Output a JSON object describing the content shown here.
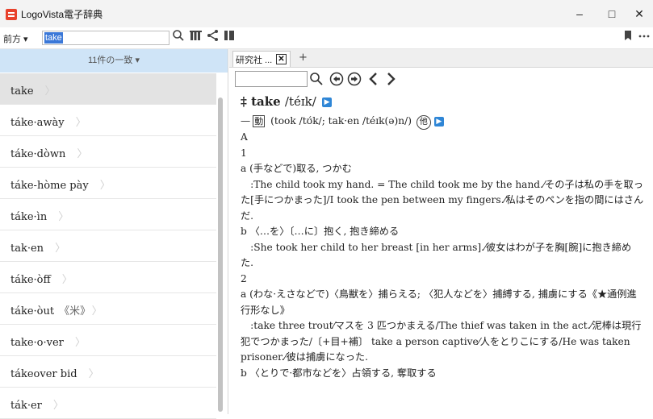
{
  "window": {
    "title": "LogoVista電子辞典",
    "minimize": "–",
    "maximize": "□",
    "close": "✕"
  },
  "toolbar": {
    "search_mode": "前方 ▾",
    "search_value": "take"
  },
  "results": {
    "summary": "11件の一致 ▾",
    "items": [
      {
        "label": "take",
        "suffix": ""
      },
      {
        "label": "táke·awày",
        "suffix": ""
      },
      {
        "label": "táke·dòwn",
        "suffix": ""
      },
      {
        "label": "táke-hòme pày",
        "suffix": ""
      },
      {
        "label": "táke·ìn",
        "suffix": ""
      },
      {
        "label": "tak·en",
        "suffix": ""
      },
      {
        "label": "táke·òff",
        "suffix": ""
      },
      {
        "label": "táke·òut",
        "suffix": "《米》"
      },
      {
        "label": "take·o·ver",
        "suffix": ""
      },
      {
        "label": "tákeover bid",
        "suffix": ""
      },
      {
        "label": "ták·er",
        "suffix": ""
      }
    ],
    "selected_index": 0
  },
  "tabs": [
    {
      "label": "研究社 ..."
    }
  ],
  "tab_add": "+",
  "entry": {
    "headword_mark": "‡",
    "headword": "take",
    "pronunciation": "/téɪk/",
    "pos_prefix": "—",
    "pos": "動",
    "forms": "(took /tʊ́k/; tak·en /téɪk(ə)n/)",
    "pos2": "他",
    "lines": [
      "A",
      "1",
      "a (手などで)取る, つかむ",
      "　:The child took my hand. = The child took me by the hand.⁄その子は私の手を取った[手につかまった]/I took the pen between my fingers.⁄私はそのペンを指の間にはさんだ.",
      "b 〈…を〉〔…に〕抱く, 抱き締める",
      "　:She took her child to her breast [in her arms].⁄彼女はわが子を胸[腕]に抱き締めた.",
      "2",
      "a (わな·えさなどで)〈鳥獣を〉捕らえる; 〈犯人などを〉捕縛する, 捕虜にする《★通例進行形なし》",
      "　:take three trout⁄マスを 3 匹つかまえる/The thief was taken in the act.⁄泥棒は現行犯でつかまった/〔+目+補〕 take a person captive⁄人をとりこにする/He was taken prisoner.⁄彼は捕虜になった.",
      "b 〈とりで·都市などを〉占領する, 奪取する"
    ]
  },
  "icons": {
    "search": "search-icon",
    "bookshelf": "bookshelf-icon",
    "share": "share-icon",
    "panel": "panel-icon",
    "bookmark": "bookmark-icon",
    "more": "more-icon",
    "history_back": "history-back-icon",
    "history_forward": "history-forward-icon",
    "prev": "prev-icon",
    "next": "next-icon"
  },
  "colors": {
    "app_icon": "#e8412b",
    "match_header": "#cfe4f7",
    "selection": "#3b78d8",
    "audio": "#2f86d6"
  }
}
